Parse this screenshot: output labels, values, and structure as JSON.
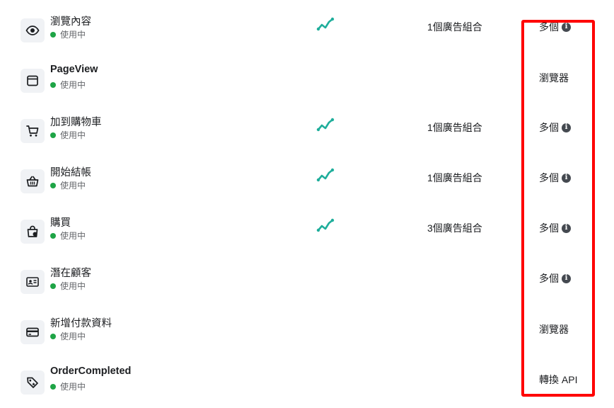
{
  "events": [
    {
      "name": "瀏覽內容",
      "status": "使用中",
      "icon": "eye-icon",
      "trend": true,
      "ad_sets": "1個廣告組合",
      "source": "多個",
      "source_info": true
    },
    {
      "name": "PageView",
      "status": "使用中",
      "icon": "browser-window-icon",
      "trend": false,
      "ad_sets": "",
      "source": "瀏覽器",
      "source_info": false
    },
    {
      "name": "加到購物車",
      "status": "使用中",
      "icon": "shopping-cart-icon",
      "trend": true,
      "ad_sets": "1個廣告組合",
      "source": "多個",
      "source_info": true
    },
    {
      "name": "開始結帳",
      "status": "使用中",
      "icon": "basket-icon",
      "trend": true,
      "ad_sets": "1個廣告組合",
      "source": "多個",
      "source_info": true
    },
    {
      "name": "購買",
      "status": "使用中",
      "icon": "shopping-bag-icon",
      "trend": true,
      "ad_sets": "3個廣告組合",
      "source": "多個",
      "source_info": true
    },
    {
      "name": "潛在顧客",
      "status": "使用中",
      "icon": "id-card-icon",
      "trend": false,
      "ad_sets": "",
      "source": "多個",
      "source_info": true
    },
    {
      "name": "新增付款資料",
      "status": "使用中",
      "icon": "credit-card-icon",
      "trend": false,
      "ad_sets": "",
      "source": "瀏覽器",
      "source_info": false
    },
    {
      "name": "OrderCompleted",
      "status": "使用中",
      "icon": "tag-icon",
      "trend": false,
      "ad_sets": "",
      "source": "轉換 API",
      "source_info": false
    }
  ],
  "info_glyph": "i",
  "colors": {
    "status_active": "#1ea446",
    "trend": "#1fae9b",
    "highlight": "#ff0000",
    "icon_bg": "#f0f2f5"
  }
}
